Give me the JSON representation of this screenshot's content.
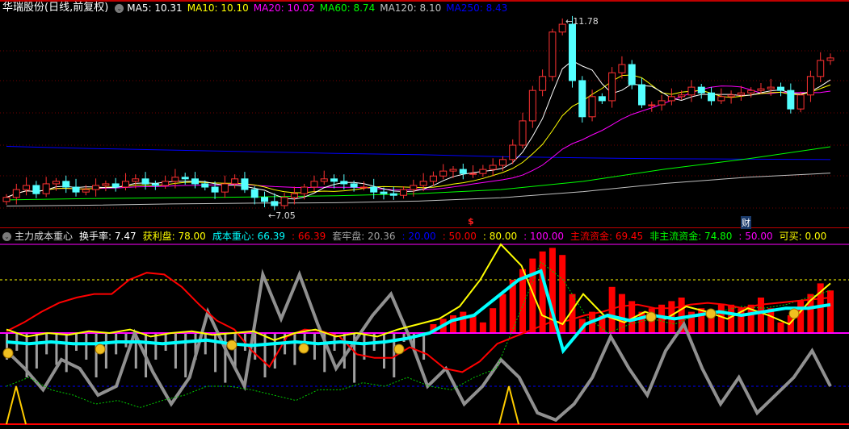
{
  "header": {
    "title": "华瑞股份(日线,前复权)",
    "ma": [
      {
        "label": "MA5: 10.31",
        "color": "#ffffff"
      },
      {
        "label": "MA10: 10.10",
        "color": "#ffff00"
      },
      {
        "label": "MA20: 10.02",
        "color": "#ff00ff"
      },
      {
        "label": "MA60: 8.74",
        "color": "#00ff00"
      },
      {
        "label": "MA120: 8.10",
        "color": "#c0c0c0"
      },
      {
        "label": "MA250: 8.43",
        "color": "#0000ff"
      }
    ]
  },
  "indicator": {
    "name": "主力成本重心",
    "items": [
      {
        "label": "换手率: 7.47",
        "color": "#ffffff"
      },
      {
        "label": "获利盘: 78.00",
        "color": "#ffff00"
      },
      {
        "label": "成本重心: 66.39",
        "color": "#00ffff"
      },
      {
        "label": ": 66.39",
        "color": "#ff0000"
      },
      {
        "label": "套牢盘: 20.36",
        "color": "#a0a0a0"
      },
      {
        "label": ": 20.00",
        "color": "#0000ff"
      },
      {
        "label": ": 50.00",
        "color": "#ff0000"
      },
      {
        "label": ": 80.00",
        "color": "#ffff00"
      },
      {
        "label": ": 100.00",
        "color": "#ff00ff"
      },
      {
        "label": "主流资金: 69.45",
        "color": "#ff0000"
      },
      {
        "label": "非主流资金: 74.80",
        "color": "#00ff00"
      },
      {
        "label": ": 50.00",
        "color": "#ff00ff"
      },
      {
        "label": "可买: 0.00",
        "color": "#ffff00"
      }
    ]
  },
  "markers": {
    "high": "11.78",
    "low": "7.05",
    "dollar": "$",
    "finance": "财"
  },
  "colors": {
    "up": "#ff3232",
    "down": "#54ffff",
    "grid": "#c00000"
  },
  "chart_data": {
    "type": "candlestick",
    "price_range": [
      6.9,
      12.1
    ],
    "closes": [
      7.51,
      7.7,
      7.8,
      7.6,
      7.84,
      7.9,
      7.76,
      7.64,
      7.7,
      7.8,
      7.84,
      7.76,
      7.9,
      7.96,
      7.84,
      7.8,
      7.9,
      8.0,
      7.96,
      7.84,
      7.76,
      7.64,
      7.84,
      7.96,
      7.7,
      7.51,
      7.41,
      7.31,
      7.51,
      7.6,
      7.76,
      7.9,
      7.96,
      7.9,
      7.84,
      7.76,
      7.76,
      7.64,
      7.6,
      7.56,
      7.7,
      7.8,
      7.9,
      8.03,
      8.15,
      8.19,
      8.09,
      8.09,
      8.19,
      8.29,
      8.43,
      8.78,
      9.37,
      10.11,
      10.45,
      11.53,
      11.72,
      10.35,
      9.47,
      9.96,
      9.86,
      10.54,
      10.74,
      10.25,
      9.76,
      9.76,
      9.86,
      9.96,
      10.0,
      10.19,
      10.05,
      9.86,
      9.96,
      10.0,
      10.05,
      10.11,
      10.15,
      10.19,
      10.11,
      9.66,
      10.0,
      10.45,
      10.84,
      10.9
    ],
    "ma60": [
      7.45,
      7.48,
      7.5,
      7.52,
      7.55,
      7.6,
      7.7,
      7.9,
      8.2,
      8.45,
      8.74
    ],
    "ma120": [
      7.3,
      7.32,
      7.35,
      7.37,
      7.38,
      7.42,
      7.5,
      7.65,
      7.85,
      8.0,
      8.1
    ],
    "ma250": [
      8.75,
      8.7,
      8.66,
      8.62,
      8.58,
      8.55,
      8.5,
      8.47,
      8.45,
      8.44,
      8.43
    ],
    "indicator_range": [
      0,
      100
    ],
    "bars": [
      35,
      40,
      25,
      30,
      38,
      32,
      28,
      40,
      35,
      25,
      30,
      38,
      42,
      30,
      25,
      35,
      40,
      30,
      25,
      35,
      38,
      28,
      22,
      30,
      40,
      35,
      25,
      30,
      38,
      32,
      42,
      35,
      28,
      40,
      30,
      22,
      35,
      40,
      30,
      25,
      45,
      40,
      35,
      55,
      58,
      60,
      62,
      60,
      56,
      64,
      72,
      80,
      86,
      92,
      96,
      98,
      94,
      72,
      58,
      62,
      60,
      76,
      72,
      68,
      62,
      64,
      66,
      68,
      70,
      62,
      64,
      60,
      66,
      66,
      64,
      66,
      70,
      64,
      56,
      60,
      68,
      72,
      78,
      74
    ],
    "gray_line": [
      40,
      30,
      18,
      35,
      30,
      15,
      20,
      50,
      28,
      10,
      25,
      62,
      40,
      20,
      83,
      58,
      83,
      55,
      30,
      45,
      60,
      72,
      48,
      20,
      30,
      10,
      20,
      35,
      25,
      5,
      1,
      10,
      25,
      48,
      30,
      15,
      40,
      55,
      30,
      10,
      25,
      5,
      15,
      25,
      40,
      20
    ],
    "red_line": [
      51,
      56,
      62,
      67,
      70,
      72,
      72,
      80,
      84,
      83,
      76,
      66,
      57,
      52,
      40,
      31,
      48,
      52,
      51,
      48,
      38,
      36,
      36,
      42,
      38,
      30,
      28,
      34,
      44,
      48,
      52,
      56,
      57,
      60,
      62,
      65,
      66,
      64,
      64,
      66,
      67,
      66,
      64,
      66,
      67,
      68,
      69,
      70
    ],
    "yellow_line": [
      52,
      48,
      50,
      49,
      51,
      50,
      52,
      48,
      50,
      51,
      49,
      50,
      51,
      46,
      50,
      52,
      48,
      50,
      48,
      52,
      55,
      58,
      65,
      80,
      100,
      88,
      60,
      55,
      72,
      60,
      56,
      62,
      58,
      65,
      62,
      58,
      64,
      60,
      55,
      68,
      78
    ],
    "cyan_line": [
      45,
      44,
      45,
      44,
      44,
      45,
      45,
      44,
      45,
      46,
      44,
      43,
      44,
      45,
      44,
      45,
      44,
      45,
      47,
      50,
      57,
      60,
      70,
      80,
      85,
      40,
      55,
      60,
      57,
      60,
      58,
      60,
      62,
      60,
      62,
      64,
      64,
      66
    ],
    "green_dashed": [
      20,
      25,
      18,
      15,
      10,
      12,
      8,
      12,
      15,
      20,
      20,
      18,
      15,
      12,
      18,
      18,
      22,
      20,
      25,
      20,
      18,
      25,
      30,
      60,
      90,
      80,
      60,
      50,
      55,
      58,
      55,
      60,
      62,
      65,
      64,
      66,
      70,
      74
    ]
  }
}
